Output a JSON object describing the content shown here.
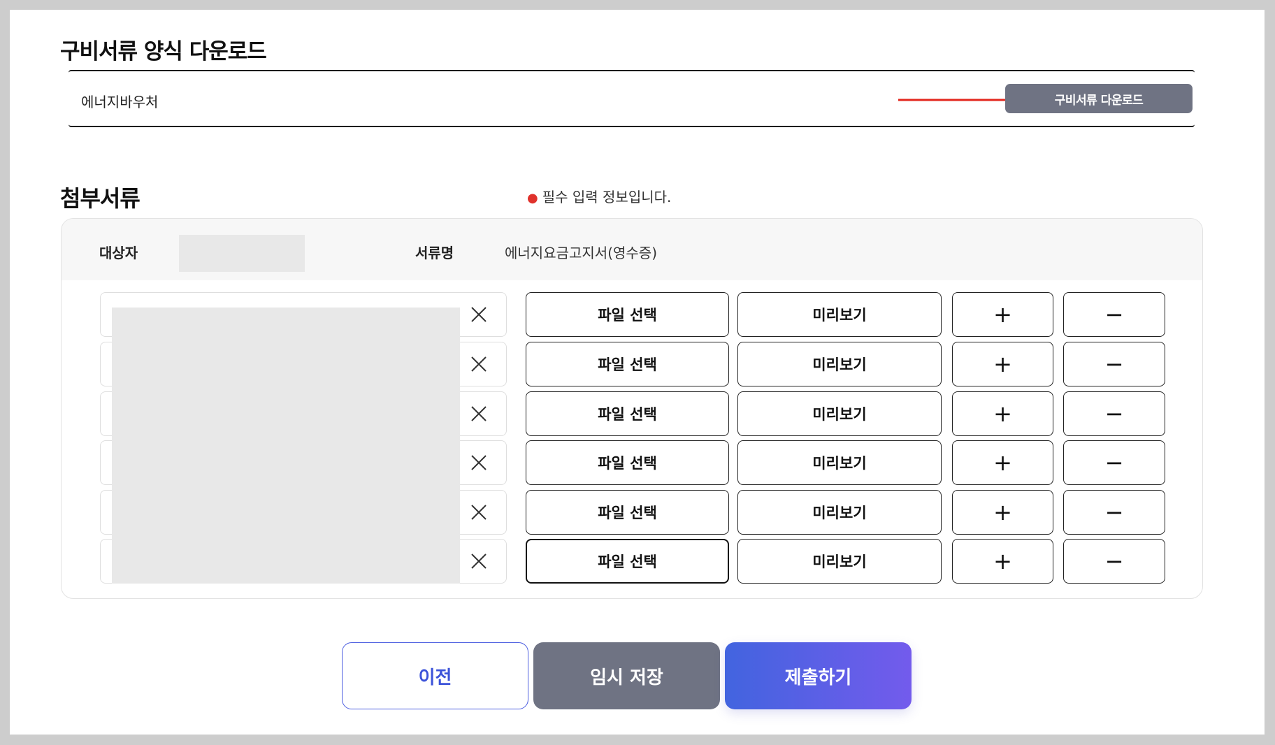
{
  "download_section": {
    "title": "구비서류 양식 다운로드",
    "item_label": "에너지바우처",
    "button_label": "구비서류 다운로드"
  },
  "attachments": {
    "title": "첨부서류",
    "required_note": "필수 입력 정보입니다.",
    "target_label": "대상자",
    "doc_name_label": "서류명",
    "doc_name_value": "에너지요금고지서(영수증)",
    "rows": [
      {
        "file_button": "파일 선택",
        "preview_button": "미리보기",
        "add": "+",
        "remove": "−"
      },
      {
        "file_button": "파일 선택",
        "preview_button": "미리보기",
        "add": "+",
        "remove": "−"
      },
      {
        "file_button": "파일 선택",
        "preview_button": "미리보기",
        "add": "+",
        "remove": "−"
      },
      {
        "file_button": "파일 선택",
        "preview_button": "미리보기",
        "add": "+",
        "remove": "−"
      },
      {
        "file_button": "파일 선택",
        "preview_button": "미리보기",
        "add": "+",
        "remove": "−"
      },
      {
        "file_button": "파일 선택",
        "preview_button": "미리보기",
        "add": "+",
        "remove": "−"
      }
    ]
  },
  "footer": {
    "prev_label": "이전",
    "save_label": "임시 저장",
    "submit_label": "제출하기"
  },
  "colors": {
    "accent_blue": "#3c53d9",
    "gray_button": "#6f7383",
    "arrow_red": "#e3261d",
    "required_dot": "#e0322c"
  },
  "icons": {
    "arrow": "arrow-right-icon",
    "clear": "close-icon",
    "required": "required-dot-icon"
  }
}
